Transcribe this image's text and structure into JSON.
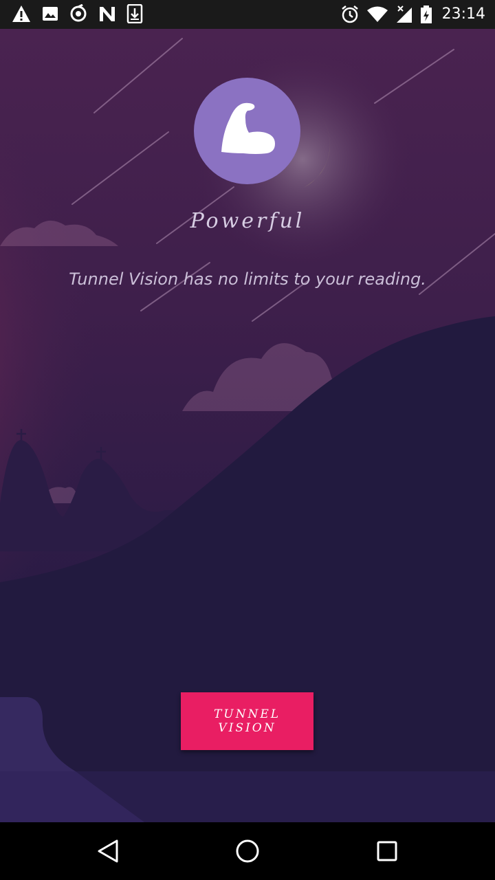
{
  "status_bar": {
    "time": "23:14",
    "left_icons": [
      "warning-icon",
      "image-icon",
      "sync-icon",
      "n-logo-icon",
      "download-icon"
    ],
    "right_icons": [
      "alarm-icon",
      "wifi-icon",
      "signal-icon",
      "battery-charging-icon"
    ]
  },
  "onboarding": {
    "feature_title": "Powerful",
    "feature_description": "Tunnel Vision has no limits to your reading.",
    "logo_icon": "flexed-arm-icon",
    "cta_label": "TUNNEL VISION"
  },
  "nav_bar": {
    "buttons": [
      "back-icon",
      "home-icon",
      "recents-icon"
    ]
  },
  "colors": {
    "logo_circle": "#8b72c2",
    "moon": "#d8cf6f",
    "cta_button": "#e91e63",
    "hills": "#221a3f"
  }
}
